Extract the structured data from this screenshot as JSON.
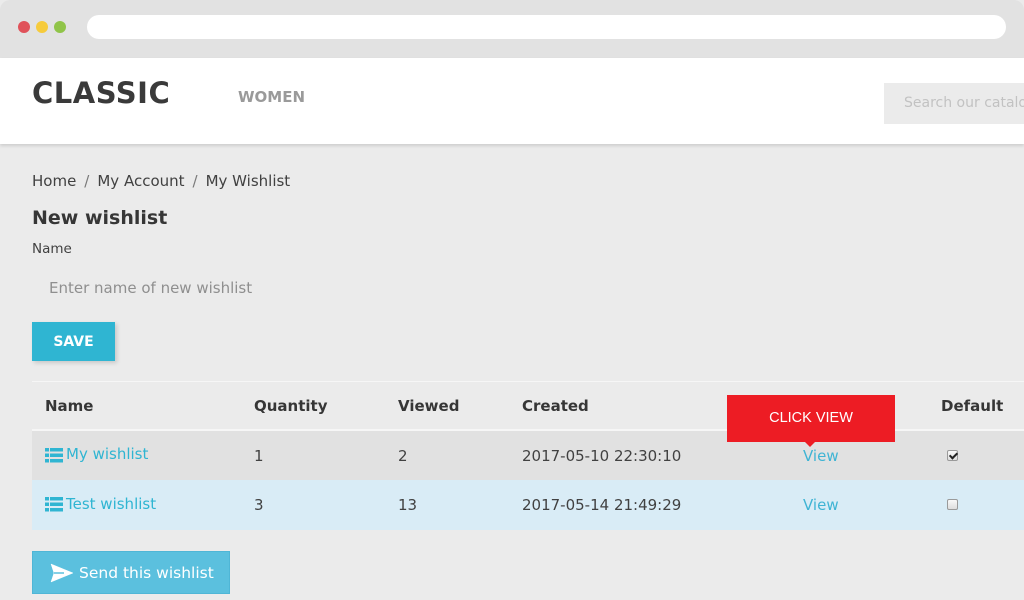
{
  "browser": {
    "controls": [
      "close",
      "minimize",
      "maximize"
    ]
  },
  "header": {
    "logo": "CLASSIC",
    "nav": [
      {
        "label": "WOMEN"
      }
    ],
    "search_placeholder": "Search our catalog"
  },
  "breadcrumb": [
    {
      "label": "Home"
    },
    {
      "label": "My Account"
    },
    {
      "label": "My Wishlist"
    }
  ],
  "breadcrumb_separator": "/",
  "form": {
    "title": "New wishlist",
    "name_label": "Name",
    "name_placeholder": "Enter name of new wishlist",
    "name_value": "",
    "save_label": "SAVE"
  },
  "table": {
    "columns": [
      "Name",
      "Quantity",
      "Viewed",
      "Created",
      "",
      "Default"
    ],
    "rows": [
      {
        "name": "My wishlist",
        "quantity": "1",
        "viewed": "2",
        "created": "2017-05-10 22:30:10",
        "action": "View",
        "default": true
      },
      {
        "name": "Test wishlist",
        "quantity": "3",
        "viewed": "13",
        "created": "2017-05-14 21:49:29",
        "action": "View",
        "default": false
      }
    ]
  },
  "tooltip": {
    "text": "CLICK VIEW",
    "color": "#ed1c24"
  },
  "send_button": {
    "label": "Send this wishlist",
    "icon": "paper-plane-icon"
  },
  "colors": {
    "accent": "#2fb5d2",
    "send_button": "#5bc0de",
    "row_highlight": "#d9ecf6"
  }
}
